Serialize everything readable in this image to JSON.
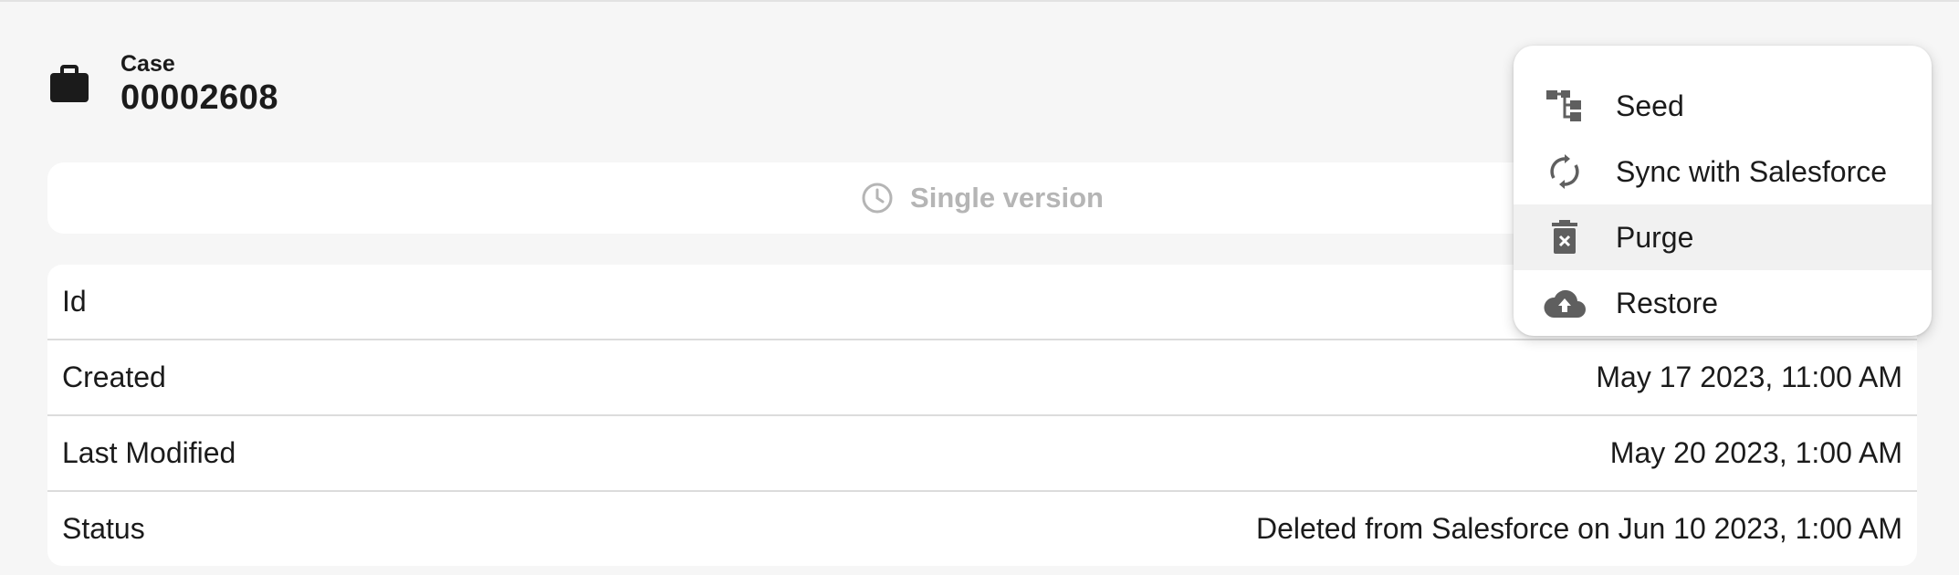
{
  "record": {
    "type_label": "Case",
    "number": "00002608",
    "icon": "briefcase-icon"
  },
  "version": {
    "label": "Single version",
    "icon": "clock-icon",
    "color": "#b5b5b5"
  },
  "details": [
    {
      "label": "Id",
      "value": ""
    },
    {
      "label": "Created",
      "value": "May 17 2023, 11:00 AM"
    },
    {
      "label": "Last Modified",
      "value": "May 20 2023, 1:00 AM"
    },
    {
      "label": "Status",
      "value": "Deleted from Salesforce on Jun 10 2023, 1:00 AM"
    }
  ],
  "menu": {
    "items": [
      {
        "label": "Seed",
        "icon": "hierarchy-icon"
      },
      {
        "label": "Sync with Salesforce",
        "icon": "sync-icon"
      },
      {
        "label": "Purge",
        "icon": "trash-icon",
        "hovered": true
      },
      {
        "label": "Restore",
        "icon": "cloud-upload-icon"
      }
    ]
  },
  "colors": {
    "background": "#f6f6f6",
    "icon_gray": "#5f5f5f",
    "text": "#1b1b1b"
  }
}
